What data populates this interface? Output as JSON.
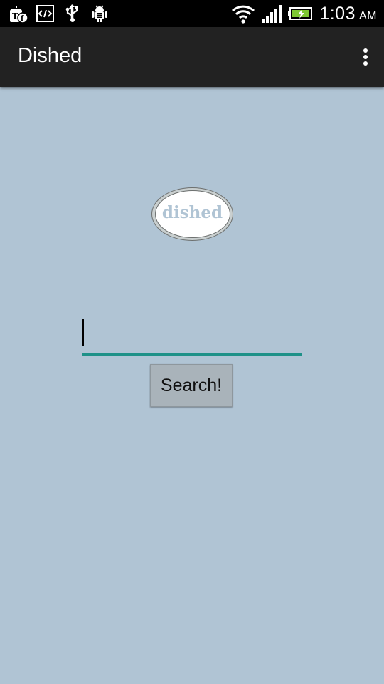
{
  "status_bar": {
    "time": "1:03",
    "ampm": "AM",
    "left_icons": [
      "tf-notification-icon",
      "code-icon",
      "usb-icon",
      "android-debug-icon"
    ],
    "right_icons": [
      "wifi-icon",
      "signal-icon",
      "battery-charging-icon"
    ],
    "battery_color": "#7ec832"
  },
  "action_bar": {
    "title": "Dished",
    "overflow_icon": "overflow-menu-icon"
  },
  "logo": {
    "text": "dished"
  },
  "search": {
    "value": "",
    "placeholder": "",
    "button_label": "Search!"
  },
  "colors": {
    "background": "#b0c4d4",
    "action_bar": "#222222",
    "input_underline": "#1e9188",
    "button": "#a9b3ba"
  }
}
